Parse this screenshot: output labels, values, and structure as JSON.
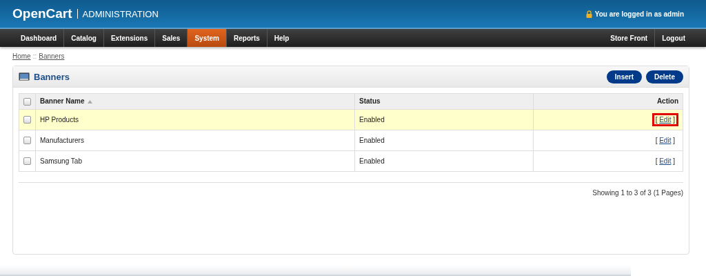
{
  "header": {
    "logo": "OpenCart",
    "subtitle": "ADMINISTRATION",
    "login_text": "You are logged in as admin"
  },
  "nav": {
    "items": [
      {
        "label": "Dashboard",
        "selected": false
      },
      {
        "label": "Catalog",
        "selected": false
      },
      {
        "label": "Extensions",
        "selected": false
      },
      {
        "label": "Sales",
        "selected": false
      },
      {
        "label": "System",
        "selected": true
      },
      {
        "label": "Reports",
        "selected": false
      },
      {
        "label": "Help",
        "selected": false
      }
    ],
    "right_items": [
      "Store Front",
      "Logout"
    ]
  },
  "breadcrumb": [
    {
      "label": "Home"
    },
    {
      "label": "Banners"
    }
  ],
  "breadcrumb_separator": "::",
  "panel": {
    "title": "Banners",
    "buttons": [
      "Insert",
      "Delete"
    ]
  },
  "table": {
    "select_all_checked": false,
    "columns": [
      {
        "label": "Banner Name",
        "sorted_ascending": true
      },
      {
        "label": "Status"
      },
      {
        "label": "Action"
      }
    ],
    "rows": [
      {
        "name": "HP Products",
        "status": "Enabled",
        "checked": false,
        "highlighted": true,
        "action": {
          "label": "Edit",
          "marked": true
        }
      },
      {
        "name": "Manufacturers",
        "status": "Enabled",
        "checked": false,
        "highlighted": false,
        "action": {
          "label": "Edit",
          "marked": false
        }
      },
      {
        "name": "Samsung Tab",
        "status": "Enabled",
        "checked": false,
        "highlighted": false,
        "action": {
          "label": "Edit",
          "marked": false
        }
      }
    ],
    "bracket_open": "[",
    "bracket_close": "]"
  },
  "pagination": "Showing 1 to 3 of 3 (1 Pages)"
}
